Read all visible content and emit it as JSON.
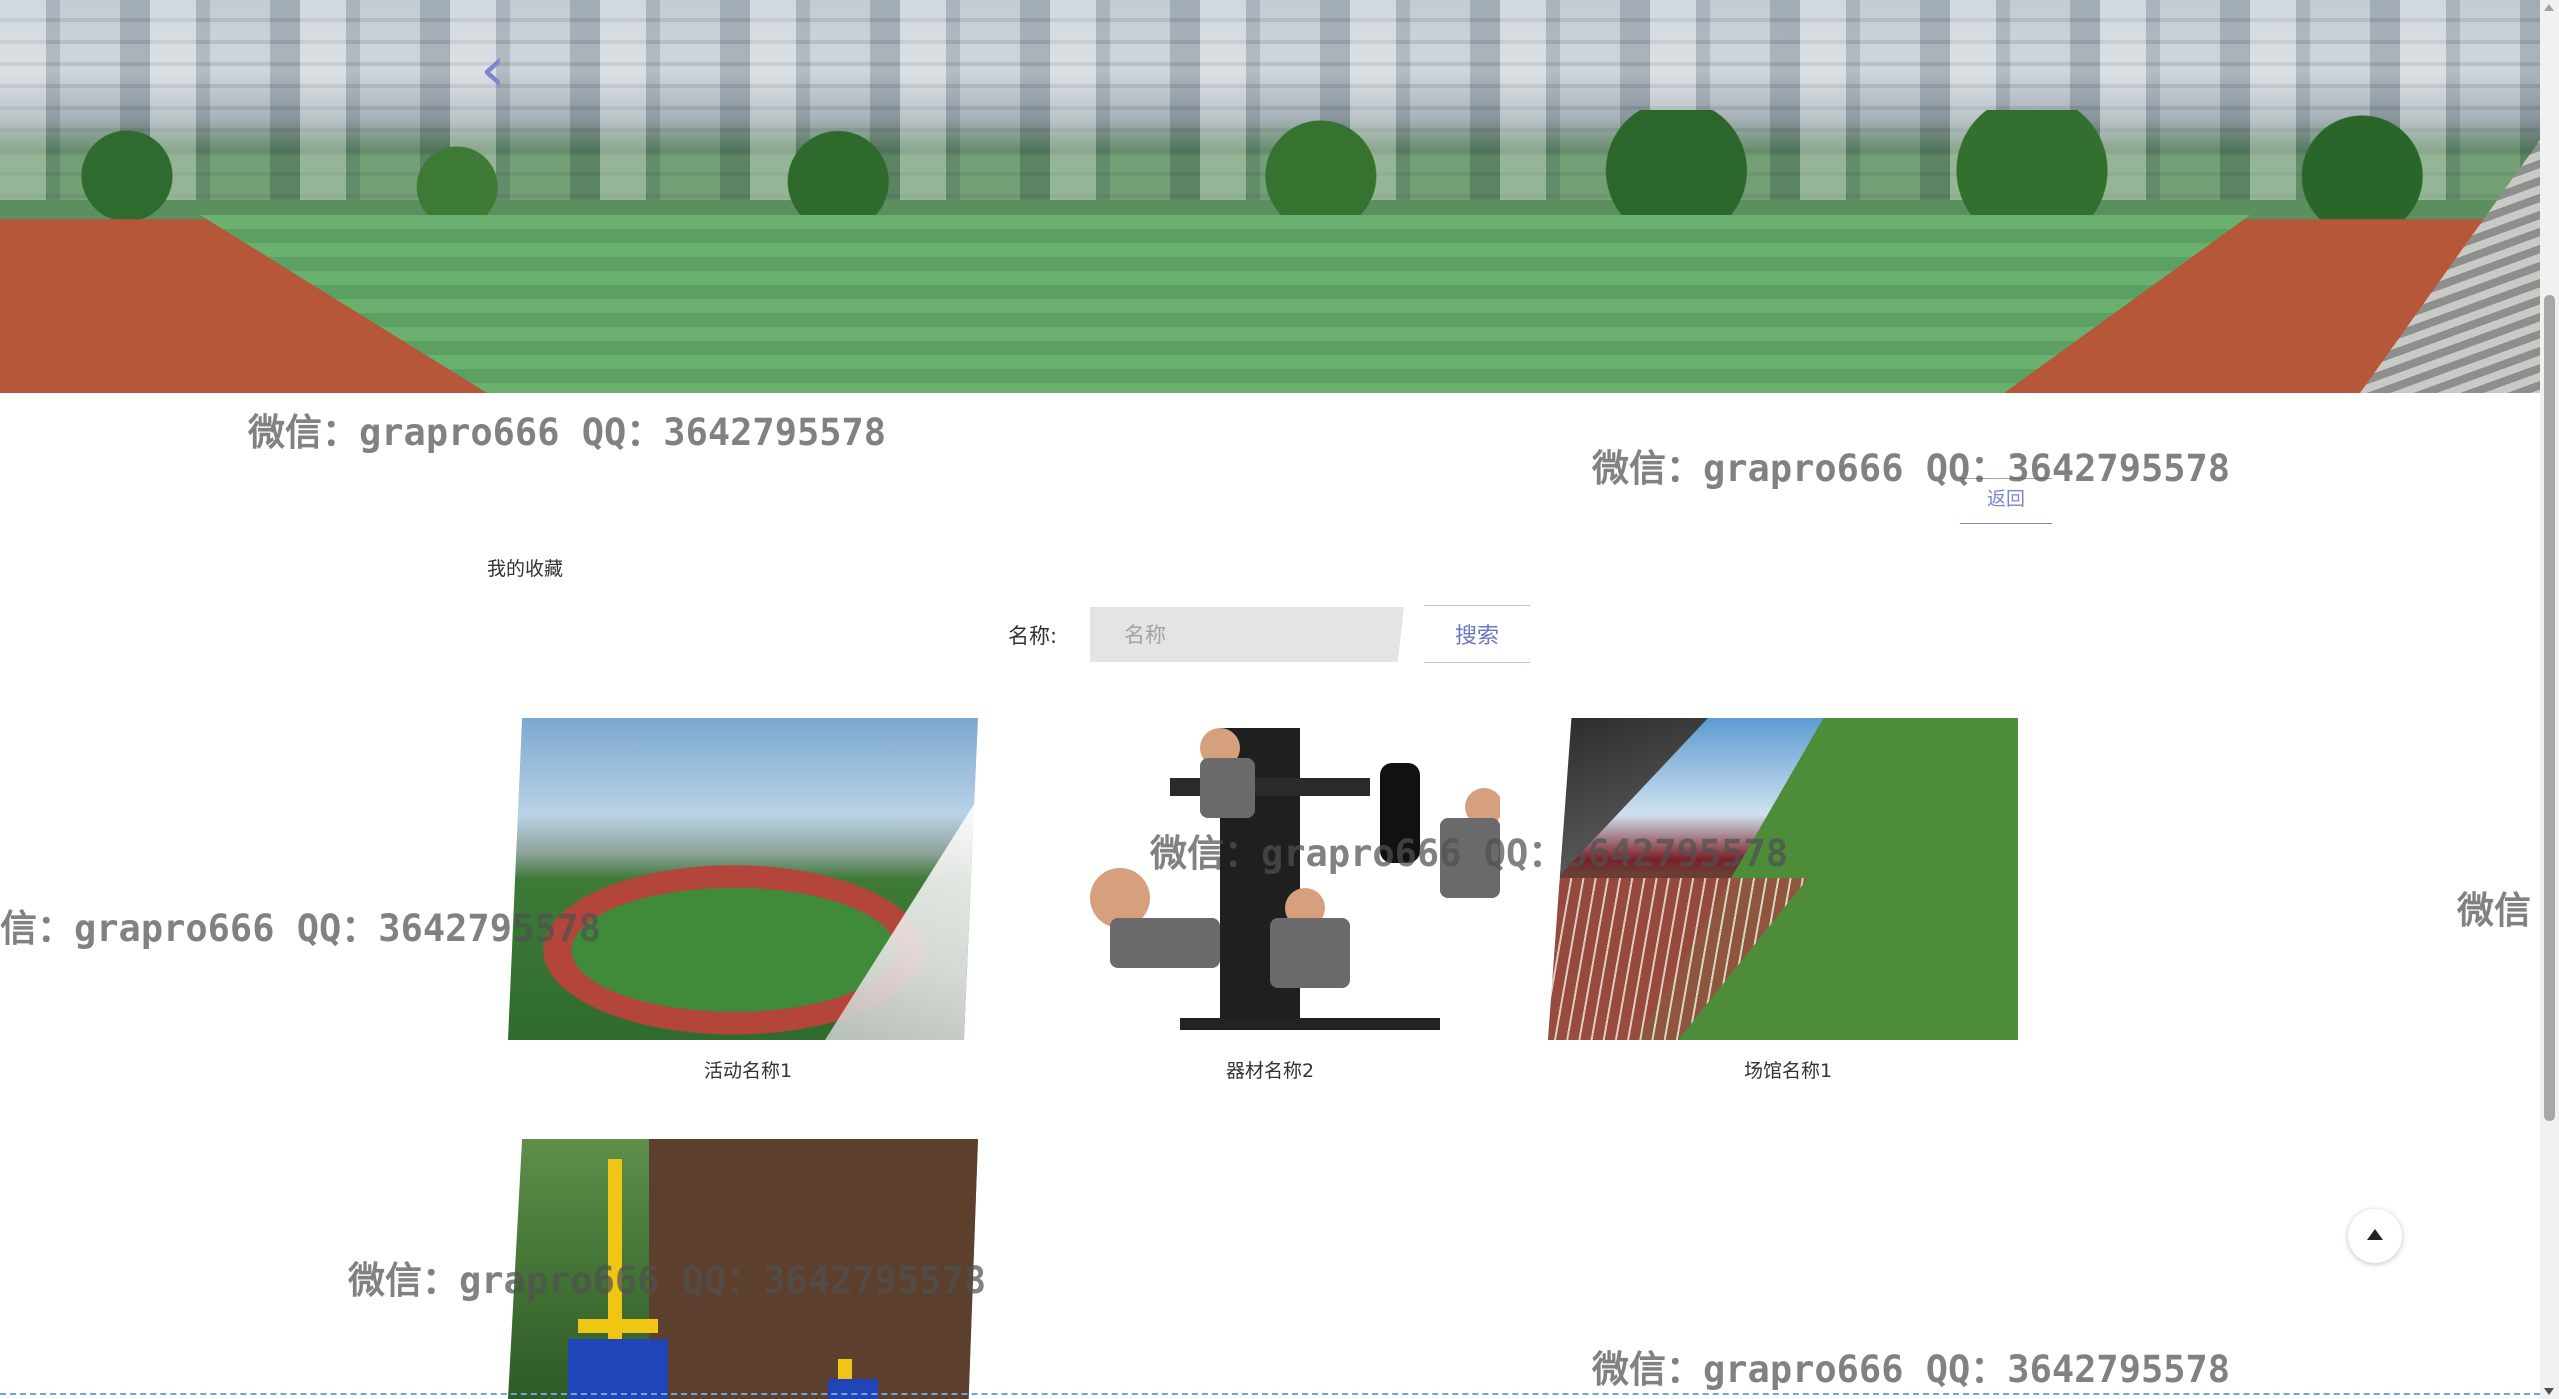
{
  "banner": {
    "prev_icon": "‹"
  },
  "header": {
    "back_label": "返回"
  },
  "breadcrumb": {
    "title": "我的收藏"
  },
  "search": {
    "label": "名称:",
    "placeholder": "名称",
    "value": "",
    "button_label": "搜索"
  },
  "items": [
    {
      "name": "活动名称1",
      "image": "stadium-track-photo"
    },
    {
      "name": "器材名称2",
      "image": "gym-equipment-photo"
    },
    {
      "name": "场馆名称1",
      "image": "stadium-panorama-photo"
    },
    {
      "name": "",
      "image": "outdoor-fitness-equipment-photo"
    }
  ],
  "watermark": {
    "text": "微信：grapro666 QQ：3642795578",
    "partial_left": "信：grapro666 QQ：3642795578",
    "partial_right": "微信"
  },
  "scroll_top": {
    "icon": "arrow-up-icon"
  }
}
